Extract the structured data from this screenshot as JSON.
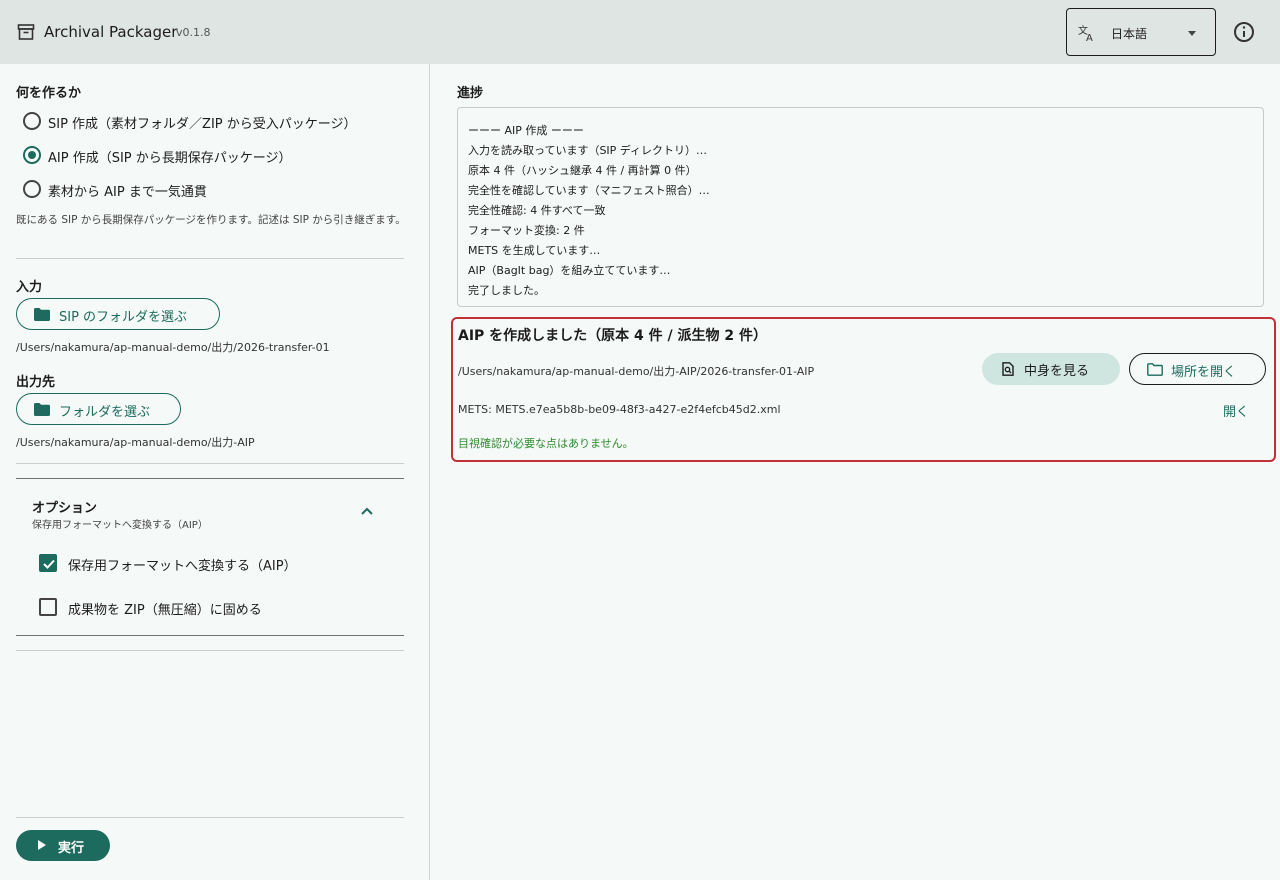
{
  "header": {
    "app_icon": "archive-box-icon",
    "title": "Archival Packager",
    "version": "v0.1.8",
    "language": {
      "icon": "translate-icon",
      "value": "日本語"
    },
    "info_icon": "info-icon"
  },
  "left": {
    "what_title": "何を作るか",
    "modes": [
      {
        "label": "SIP 作成（素材フォルダ／ZIP から受入パッケージ）",
        "selected": false
      },
      {
        "label": "AIP 作成（SIP から長期保存パッケージ）",
        "selected": true
      },
      {
        "label": "素材から AIP まで一気通貫",
        "selected": false
      }
    ],
    "hint": "既にある SIP から長期保存パッケージを作ります。記述は SIP から引き継ぎます。",
    "input": {
      "title": "入力",
      "button": "SIP のフォルダを選ぶ",
      "path": "/Users/nakamura/ap-manual-demo/出力/2026-transfer-01"
    },
    "output": {
      "title": "出力先",
      "button": "フォルダを選ぶ",
      "path": "/Users/nakamura/ap-manual-demo/出力-AIP"
    },
    "options": {
      "title": "オプション",
      "subtitle": "保存用フォーマットへ変換する（AIP）",
      "items": [
        {
          "label": "保存用フォーマットへ変換する（AIP）",
          "checked": true
        },
        {
          "label": "成果物を ZIP（無圧縮）に固める",
          "checked": false
        }
      ]
    },
    "run_button": "実行"
  },
  "progress": {
    "title": "進捗",
    "log": [
      "ーーー AIP 作成 ーーー",
      "入力を読み取っています（SIP ディレクトリ）…",
      "原本 4 件（ハッシュ継承 4 件 / 再計算 0 件）",
      "完全性を確認しています（マニフェスト照合）…",
      "完全性確認: 4 件すべて一致",
      "フォーマット変換: 2 件",
      "METS を生成しています…",
      "AIP（BagIt bag）を組み立てています…",
      "完了しました。"
    ]
  },
  "result": {
    "title": "AIP を作成しました（原本 4 件 / 派生物 2 件）",
    "path": "/Users/nakamura/ap-manual-demo/出力-AIP/2026-transfer-01-AIP",
    "view_button": "中身を見る",
    "open_location_button": "場所を開く",
    "mets": "METS: METS.e7ea5b8b-be09-48f3-a427-e2f4efcb45d2.xml",
    "mets_open": "開く",
    "status_message": "目視確認が必要な点はありません。"
  },
  "colors": {
    "accent": "#1c6b5e",
    "header_bg": "#dfe5e2",
    "page_bg": "#f5f9f7",
    "highlight_border": "#c2303a",
    "success": "#2e8b2e"
  }
}
